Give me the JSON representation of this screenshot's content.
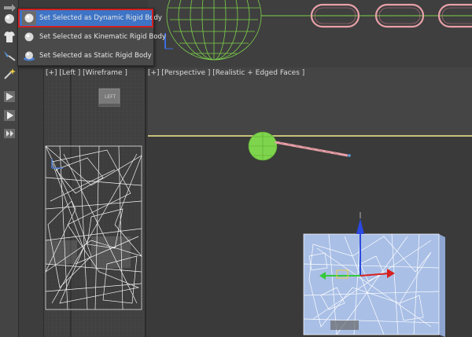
{
  "menu": {
    "items": [
      {
        "label": "Set Selected as Dynamic Rigid Body",
        "icon": "dynamic-rigid-body-icon",
        "selected": true
      },
      {
        "label": "Set Selected as Kinematic Rigid Body",
        "icon": "kinematic-rigid-body-icon",
        "selected": false
      },
      {
        "label": "Set Selected as Static Rigid Body",
        "icon": "static-rigid-body-icon",
        "selected": false
      }
    ],
    "highlight_color": "#3e74c6",
    "outline_color": "#d22020"
  },
  "viewports": {
    "left_label": "[+] [Left ] [Wireframe ]",
    "perspective_label": "[+] [Perspective ] [Realistic + Edged Faces ]",
    "left_view_cube_label": "LEFT"
  },
  "toolbar": {
    "icons": [
      "rigid-body-sphere-icon",
      "cloth-shirt-icon",
      "constraint-tool-icon",
      "sparkle-tool-icon",
      "mcloth-play-icon",
      "simulate-play-icon",
      "bake-icon"
    ]
  },
  "colors": {
    "accent_selection": "#3e74c6",
    "wire_green": "#7cd24a",
    "chain_pink": "#e8a0a8",
    "wall_blue": "#a9bfe6"
  }
}
